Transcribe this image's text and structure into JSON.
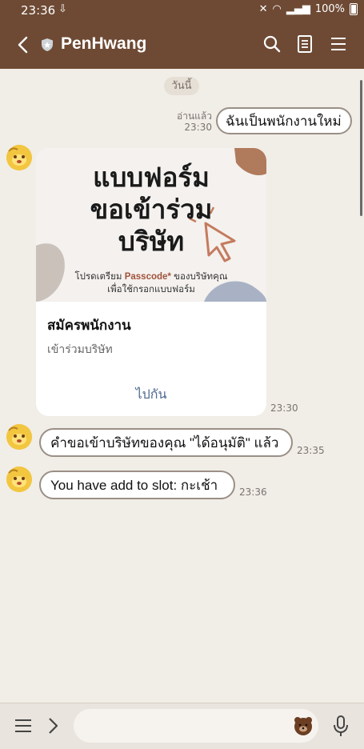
{
  "status": {
    "time": "23:36",
    "battery": "100%"
  },
  "header": {
    "title": "PenHwang"
  },
  "date_chip": "วันนี้",
  "messages": [
    {
      "kind": "sent",
      "text": "ฉันเป็นพนักงานใหม่",
      "read": "อ่านแล้ว",
      "time": "23:30"
    },
    {
      "kind": "card",
      "image_title_1": "แบบฟอร์ม",
      "image_title_2": "ขอเข้าร่วม",
      "image_title_3": "บริษัท",
      "image_sub_prefix": "โปรดเตรียม",
      "image_sub_code": "Passcode*",
      "image_sub_suffix": "ของบริษัทคุณ",
      "image_sub_2": "เพื่อใช้กรอกแบบฟอร์ม",
      "title": "สมัครพนักงาน",
      "desc": "เข้าร่วมบริษัท",
      "action": "ไปกัน",
      "time": "23:30"
    },
    {
      "kind": "received",
      "text": "คำขอเข้าบริษัทของคุณ \"ได้อนุมัติ\" แล้ว",
      "time": "23:35"
    },
    {
      "kind": "received",
      "text": "You have add to slot: กะเช้า",
      "time": "23:36"
    }
  ],
  "input": {
    "placeholder": ""
  },
  "colors": {
    "header": "#6e4a34",
    "background": "#f1ede7",
    "link": "#4d6890"
  }
}
